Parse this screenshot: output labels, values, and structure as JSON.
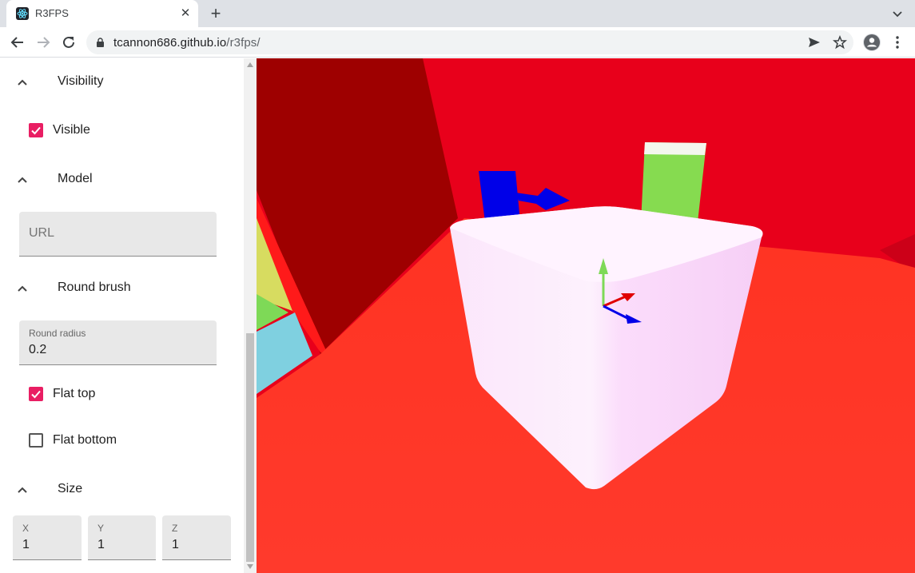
{
  "browser": {
    "tab_title": "R3FPS",
    "url_host": "tcannon686.github.io",
    "url_path": "/r3fps/"
  },
  "panel": {
    "sections": {
      "visibility": {
        "title": "Visibility",
        "visible_label": "Visible",
        "visible_checked": true
      },
      "model": {
        "title": "Model",
        "url_placeholder": "URL"
      },
      "round_brush": {
        "title": "Round brush",
        "radius_label": "Round radius",
        "radius_value": "0.2",
        "flat_top_label": "Flat top",
        "flat_top_checked": true,
        "flat_bottom_label": "Flat bottom",
        "flat_bottom_checked": false
      },
      "size": {
        "title": "Size",
        "x_label": "X",
        "x_value": "1",
        "y_label": "Y",
        "y_value": "1",
        "z_label": "Z",
        "z_value": "1"
      }
    }
  },
  "colors": {
    "accent": "#e91e63",
    "floor": "#ff3a2a",
    "wall": "#e8001b",
    "wall_dark": "#9e0000"
  }
}
